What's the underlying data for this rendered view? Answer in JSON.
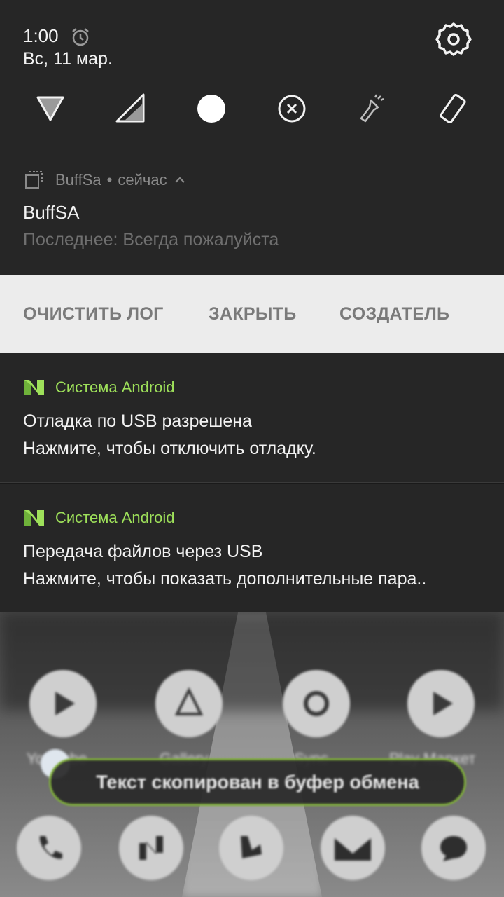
{
  "quick_settings": {
    "time": "1:00",
    "date": "Вс, 11 мар.",
    "icons": [
      "alarm-icon",
      "settings-gear-icon",
      "wifi-icon",
      "cellular-signal-icon",
      "do-not-disturb-icon",
      "data-saver-icon",
      "flashlight-icon",
      "auto-rotate-icon"
    ]
  },
  "buff_notification": {
    "app_name": "BuffSa",
    "time_separator": "•",
    "time": "сейчас",
    "title": "BuffSA",
    "text": "Последнее: Всегда пожалуйста",
    "actions": [
      "ОЧИСТИТЬ ЛОГ",
      "ЗАКРЫТЬ",
      "СОЗДАТЕЛЬ"
    ]
  },
  "android_notifications": [
    {
      "app_name": "Система Android",
      "title": "Отладка по USB разрешена",
      "text": "Нажмите, чтобы отключить отладку."
    },
    {
      "app_name": "Система Android",
      "title": "Передача файлов через USB",
      "text": "Нажмите, чтобы показать дополнительные пара.."
    }
  ],
  "home_screen": {
    "toast": "Текст скопирован в буфер обмена",
    "app_labels": [
      "YouTube",
      "Gallery",
      "Sync",
      "Play Маркет"
    ]
  },
  "colors": {
    "panel_bg": "#262626",
    "android_accent": "#9ee05a",
    "actions_bg": "#ececec",
    "toast_border": "#7fae3a"
  }
}
